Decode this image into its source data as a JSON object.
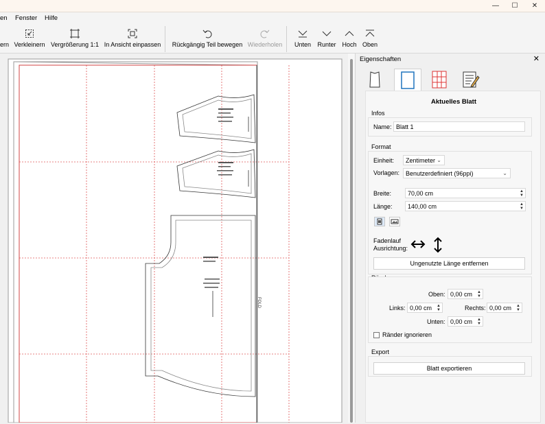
{
  "window": {
    "minimize": "—",
    "maximize": "☐",
    "close": "✕"
  },
  "menu": [
    "en",
    "Fenster",
    "Hilfe"
  ],
  "toolbar": {
    "zoom_out": "ern",
    "shrink": "Verkleinern",
    "zoom_1_1": "Vergrößerung 1:1",
    "fit_view": "In Ansicht einpassen",
    "undo_move": "Rückgängig Teil bewegen",
    "redo": "Wiederholen",
    "bottom": "Unten",
    "down": "Runter",
    "up": "Hoch",
    "top": "Oben"
  },
  "canvas": {
    "fold_label": "FOLD"
  },
  "panel": {
    "title": "Eigenschaften",
    "close": "✕",
    "tabs": [
      "piece-icon",
      "sheet-icon",
      "tiles-icon",
      "notes-icon"
    ],
    "heading": "Aktuelles Blatt",
    "infos": {
      "section": "Infos",
      "name_label": "Name:",
      "name_value": "Blatt 1"
    },
    "format": {
      "section": "Format",
      "unit_label": "Einheit:",
      "unit_value": "Zentimeter",
      "templates_label": "Vorlagen:",
      "templates_value": "Benutzerdefiniert (96ppi)",
      "width_label": "Breite:",
      "width_value": "70,00 cm",
      "length_label": "Länge:",
      "length_value": "140,00 cm",
      "grainline_label_1": "Fadenlauf",
      "grainline_label_2": "Ausrichtung:",
      "remove_length_button": "Ungenutzte Länge entfernen"
    },
    "margins": {
      "section": "Ränder",
      "top_label": "Oben:",
      "top_value": "0,00 cm",
      "left_label": "Links:",
      "left_value": "0,00 cm",
      "right_label": "Rechts:",
      "right_value": "0,00 cm",
      "bottom_label": "Unten:",
      "bottom_value": "0,00 cm",
      "ignore_label": "Ränder ignorieren"
    },
    "export": {
      "section": "Export",
      "button": "Blatt exportieren"
    }
  }
}
